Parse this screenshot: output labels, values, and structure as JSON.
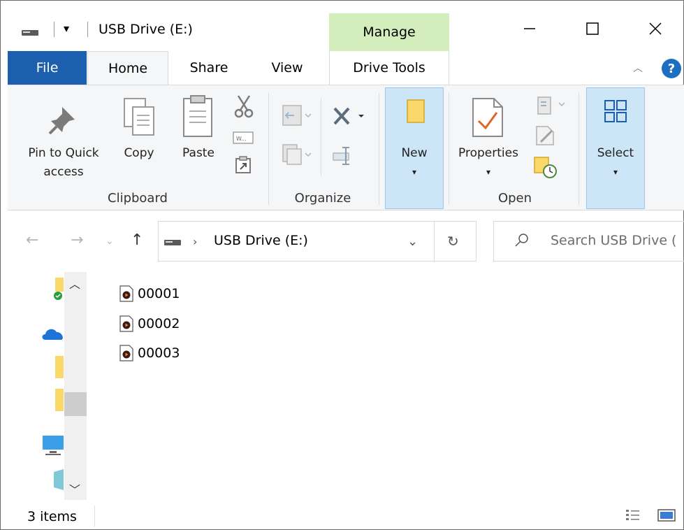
{
  "titlebar": {
    "title": "USB Drive (E:)",
    "quick_access_caret": "▾",
    "contextual_tab": "Manage"
  },
  "tabs": {
    "file": "File",
    "home": "Home",
    "share": "Share",
    "view": "View",
    "drive_tools": "Drive Tools"
  },
  "ribbon": {
    "clipboard": {
      "group": "Clipboard",
      "pin_line1": "Pin to Quick",
      "pin_line2": "access",
      "copy": "Copy",
      "paste": "Paste"
    },
    "organize": {
      "group": "Organize"
    },
    "new": {
      "label": "New",
      "caret": "▾"
    },
    "open": {
      "group": "Open",
      "properties": "Properties",
      "caret": "▾"
    },
    "select": {
      "label": "Select",
      "caret": "▾"
    }
  },
  "address": {
    "path": "USB Drive (E:)",
    "chevron": "›"
  },
  "search": {
    "placeholder": "Search USB Drive ("
  },
  "files": [
    {
      "name": "00001"
    },
    {
      "name": "00002"
    },
    {
      "name": "00003"
    }
  ],
  "status": {
    "count": "3 items"
  },
  "colors": {
    "file_tab": "#1b5fae",
    "manage_tab": "#d4edbd",
    "selected_button": "#cde6f7",
    "ribbon_bg": "#f5f6f7"
  }
}
